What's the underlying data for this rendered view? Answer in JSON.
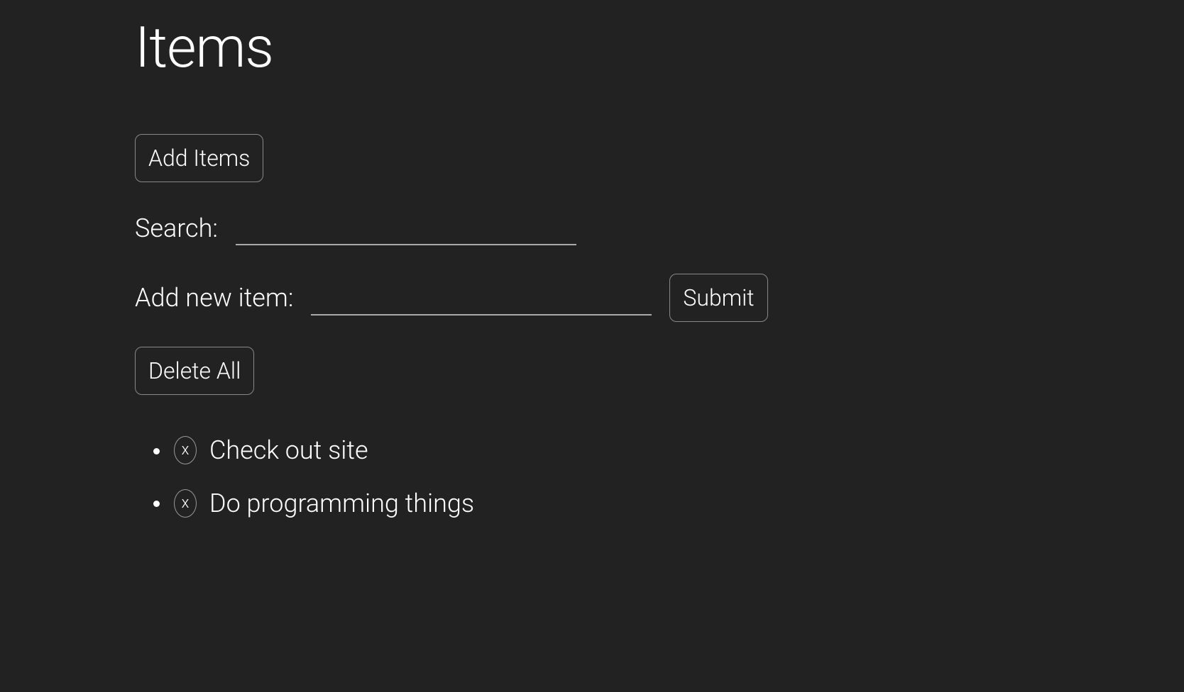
{
  "title": "Items",
  "buttons": {
    "add_items": "Add Items",
    "submit": "Submit",
    "delete_all": "Delete All"
  },
  "labels": {
    "search": "Search:",
    "add_new": "Add new item:"
  },
  "inputs": {
    "search_value": "",
    "add_value": ""
  },
  "delete_icon_label": "x",
  "items": [
    {
      "text": "Check out site"
    },
    {
      "text": "Do programming things"
    }
  ]
}
